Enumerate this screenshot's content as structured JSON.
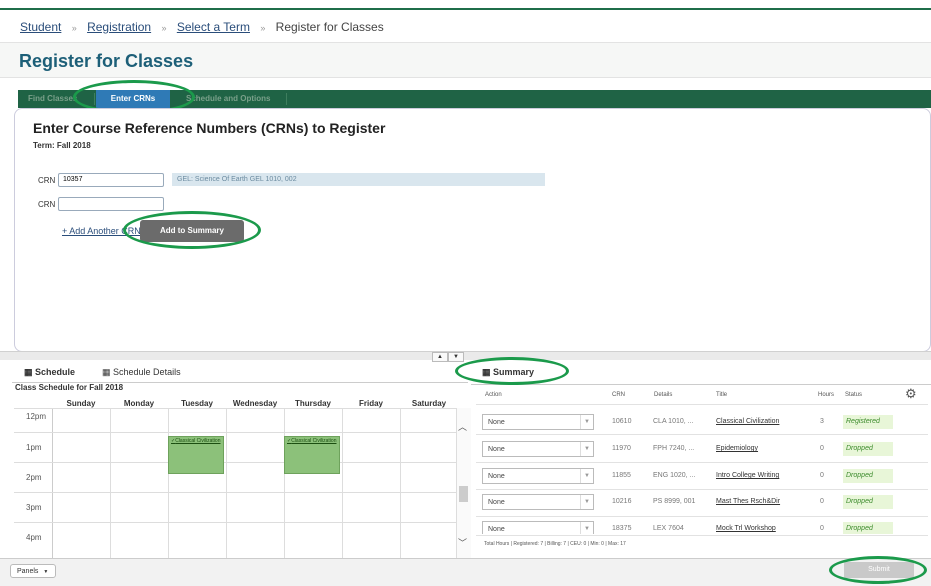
{
  "breadcrumb": {
    "items": [
      "Student",
      "Registration",
      "Select a Term"
    ],
    "current": "Register for Classes",
    "separator": "»"
  },
  "page": {
    "title": "Register for Classes"
  },
  "tabs": [
    {
      "label": "Find Classes",
      "active": false
    },
    {
      "label": "Enter CRNs",
      "active": true
    },
    {
      "label": "Schedule and Options",
      "active": false
    }
  ],
  "crn_panel": {
    "heading": "Enter Course Reference Numbers (CRNs) to Register",
    "term": "Term: Fall 2018",
    "crn_label": "CRN",
    "crn1_value": "10357",
    "crn2_value": "",
    "course_info": "GEL: Science Of Earth GEL 1010, 002",
    "add_another_link": "+ Add Another CRN",
    "add_to_summary_button": "Add to Summary"
  },
  "schedule": {
    "tab_schedule": "Schedule",
    "tab_details": "Schedule Details",
    "title": "Class Schedule for Fall 2018",
    "days": [
      "Sunday",
      "Monday",
      "Tuesday",
      "Wednesday",
      "Thursday",
      "Friday",
      "Saturday"
    ],
    "hours": [
      "12pm",
      "1pm",
      "2pm",
      "3pm",
      "4pm"
    ],
    "blocks": [
      {
        "day": "Tuesday",
        "label": "Classical Civilization"
      },
      {
        "day": "Thursday",
        "label": "Classical Civilization"
      }
    ]
  },
  "summary": {
    "title": "Summary",
    "columns": [
      "Action",
      "CRN",
      "Details",
      "Title",
      "Hours",
      "Status"
    ],
    "rows": [
      {
        "action": "None",
        "crn": "10610",
        "details": "CLA 1010, ...",
        "title": "Classical Civilization",
        "hours": "3",
        "status": "Registered"
      },
      {
        "action": "None",
        "crn": "11970",
        "details": "FPH 7240, ...",
        "title": "Epidemiology",
        "hours": "0",
        "status": "Dropped"
      },
      {
        "action": "None",
        "crn": "11855",
        "details": "ENG 1020, ...",
        "title": "Intro College Writing",
        "hours": "0",
        "status": "Dropped"
      },
      {
        "action": "None",
        "crn": "10216",
        "details": "PS 8999, 001",
        "title": "Mast Thes Rsch&Dir",
        "hours": "0",
        "status": "Dropped"
      },
      {
        "action": "None",
        "crn": "18375",
        "details": "LEX 7604",
        "title": "Mock Trl Workshop",
        "hours": "0",
        "status": "Dropped"
      }
    ],
    "totals": "Total Hours | Registered: 7 | Billing: 7 | CEU: 0 | Min: 0 | Max: 17"
  },
  "footer": {
    "panels_button": "Panels",
    "submit_button": "Submit"
  },
  "colors": {
    "brand_green": "#1f6345",
    "highlight_ring": "#1b9a4b",
    "active_tab": "#2f7ab6",
    "title_blue": "#1d5f78"
  },
  "icons": [
    "calendar-icon",
    "gear-icon",
    "chevron-down-icon",
    "check-icon"
  ]
}
